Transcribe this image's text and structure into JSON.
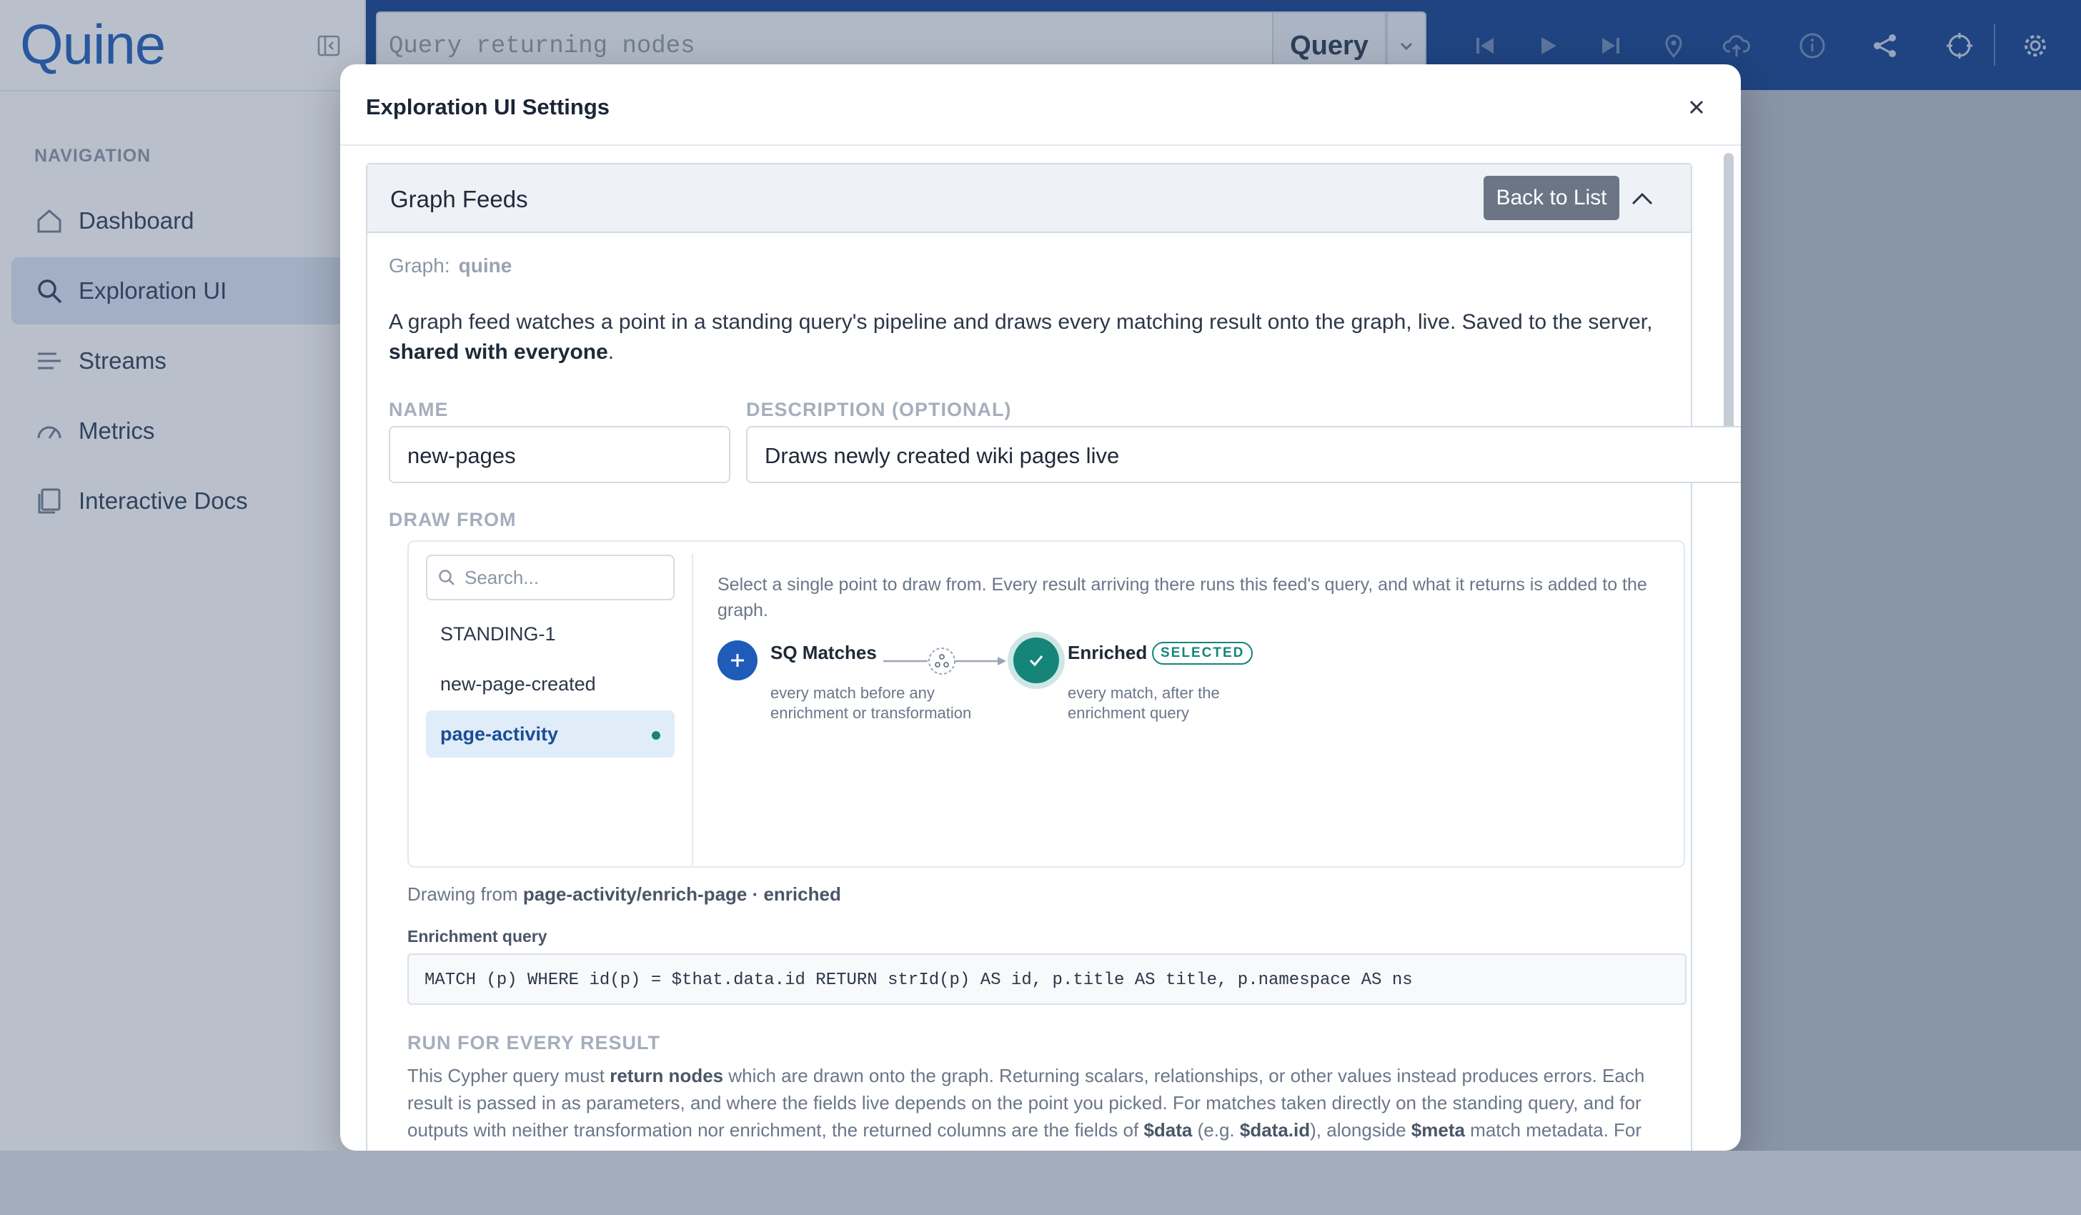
{
  "app": {
    "logo": "Quine"
  },
  "sidebar": {
    "heading": "NAVIGATION",
    "items": [
      {
        "label": "Dashboard",
        "icon": "home-icon",
        "active": false
      },
      {
        "label": "Exploration UI",
        "icon": "search-icon",
        "active": true
      },
      {
        "label": "Streams",
        "icon": "streams-icon",
        "active": false
      },
      {
        "label": "Metrics",
        "icon": "gauge-icon",
        "active": false
      },
      {
        "label": "Interactive Docs",
        "icon": "docs-icon",
        "active": false
      }
    ]
  },
  "topbar": {
    "query_placeholder": "Query returning nodes",
    "query_button": "Query",
    "tools": [
      "skip-back-icon",
      "play-icon",
      "skip-forward-icon",
      "map-pin-icon",
      "cloud-upload-icon",
      "info-icon",
      "share-icon",
      "crosshair-icon",
      "gear-icon"
    ]
  },
  "modal": {
    "title": "Exploration UI Settings",
    "section_title": "Graph Feeds",
    "back_button": "Back to List",
    "graph_label": "Graph:",
    "graph_name": "quine",
    "description_main": "A graph feed watches a point in a standing query's pipeline and draws every matching result onto the graph, live. Saved to the server,",
    "description_bold": "shared with everyone",
    "description_end": ".",
    "name_label": "NAME",
    "name_value": "new-pages",
    "description_label": "DESCRIPTION (OPTIONAL)",
    "description_value": "Draws newly created wiki pages live",
    "draw_from_label": "DRAW FROM",
    "search_placeholder": "Search...",
    "queries": [
      {
        "label": "STANDING-1",
        "selected": false
      },
      {
        "label": "new-page-created",
        "selected": false
      },
      {
        "label": "page-activity",
        "selected": true
      }
    ],
    "hint": "Select a single point to draw from. Every result arriving there runs this feed's query, and what it returns is added to the graph.",
    "pipeline": {
      "sq_title": "SQ Matches",
      "sq_sub_1": "every match before any",
      "sq_sub_2": "enrichment or transformation",
      "enriched_title": "Enriched",
      "enriched_badge": "SELECTED",
      "enriched_sub_1": "every match, after the",
      "enriched_sub_2": "enrichment query"
    },
    "drawing_from_prefix": "Drawing from",
    "drawing_from_value": "page-activity/enrich-page · enriched",
    "enrichment_label": "Enrichment query",
    "enrichment_query": "MATCH (p) WHERE id(p) = $that.data.id RETURN strId(p) AS id, p.title AS title, p.namespace AS ns",
    "run_label": "RUN FOR EVERY RESULT",
    "run_text_1": "This Cypher query must",
    "run_text_bold_1": "return nodes",
    "run_text_2": "which are drawn onto the graph. Returning scalars, relationships, or other values instead produces errors. Each result is passed in as parameters, and where the fields live depends on the point you picked. For matches taken directly on the standing query, and for outputs with neither transformation nor enrichment, the returned columns are the fields of",
    "run_text_bold_2": "$data",
    "run_text_3": "(e.g.",
    "run_text_bold_3": "$data.id",
    "run_text_4": "), alongside",
    "run_text_bold_4": "$meta",
    "run_text_5": "match metadata. For"
  },
  "colors": {
    "brand": "#1f5bb8",
    "topbar": "#0f3d8c",
    "accent_teal": "#15857a",
    "selected_bg": "#e1ecf9"
  }
}
